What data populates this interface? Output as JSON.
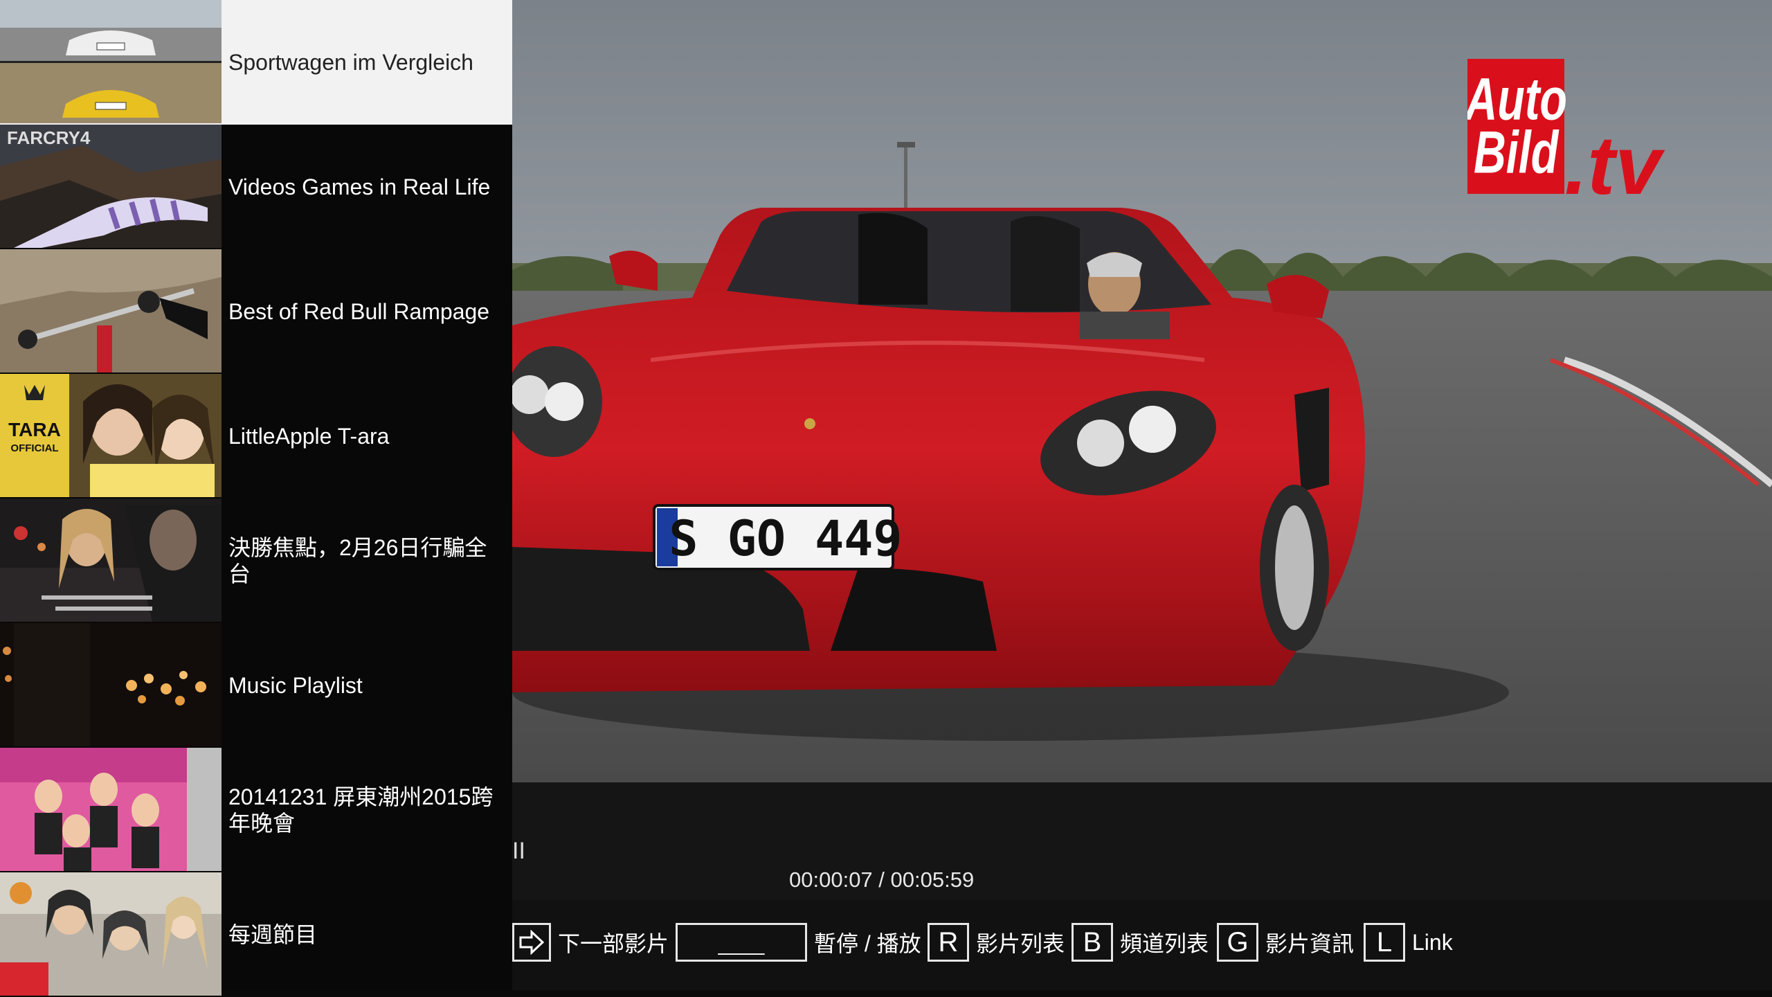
{
  "playlist": [
    {
      "title": "Sportwagen im Vergleich",
      "selected": true
    },
    {
      "title": "Videos Games in Real Life",
      "thumb_text": "FARCRY4"
    },
    {
      "title": "Best of Red Bull Rampage"
    },
    {
      "title": "LittleApple T-ara",
      "thumb_text": "TARA",
      "thumb_sub": "OFFICIAL"
    },
    {
      "title": "決勝焦點，2月26日行騙全台"
    },
    {
      "title": "Music Playlist"
    },
    {
      "title": "20141231 屏東潮州2015跨年晚會"
    },
    {
      "title": "每週節目"
    }
  ],
  "video": {
    "logo_main": "Auto Bild",
    "logo_suffix": ".tv",
    "plate": "S GO 449"
  },
  "player": {
    "state_icon": "II",
    "time": "00:00:07 / 00:05:59"
  },
  "shortcuts": {
    "next": {
      "key_icon": "arrow-right-icon",
      "label": "下一部影片"
    },
    "pause": {
      "key": "____",
      "label": "暫停 / 播放"
    },
    "video_list": {
      "key": "R",
      "label": "影片列表"
    },
    "channel_list": {
      "key": "B",
      "label": "頻道列表"
    },
    "video_info": {
      "key": "G",
      "label": "影片資訊"
    },
    "link": {
      "key": "L",
      "label": "Link"
    }
  },
  "colors": {
    "selected_bg": "#f2f2f2",
    "car_red": "#c8161e",
    "logo_red": "#d9101c"
  }
}
